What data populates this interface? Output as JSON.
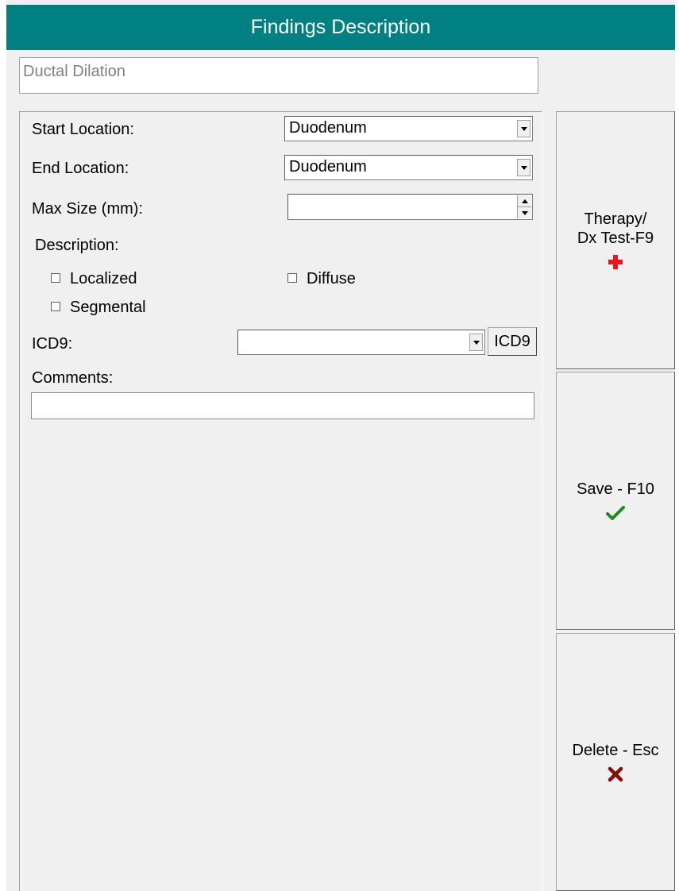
{
  "header": {
    "title": "Findings Description"
  },
  "finding_name": "Ductal Dilation",
  "form": {
    "start_location": {
      "label": "Start Location:",
      "value": "Duodenum"
    },
    "end_location": {
      "label": "End Location:",
      "value": "Duodenum"
    },
    "max_size": {
      "label": "Max Size (mm):",
      "value": ""
    },
    "description": {
      "label": "Description:",
      "options": [
        {
          "label": "Localized",
          "checked": false
        },
        {
          "label": "Diffuse",
          "checked": false
        },
        {
          "label": "Segmental",
          "checked": false
        }
      ]
    },
    "icd9": {
      "label": "ICD9:",
      "value": "",
      "button_label": "ICD9"
    },
    "comments": {
      "label": "Comments:",
      "value": ""
    }
  },
  "side_buttons": {
    "therapy": {
      "line1": "Therapy/",
      "line2": "Dx Test-F9",
      "icon": "red-cross-icon",
      "color": "#e8141e"
    },
    "save": {
      "label": "Save - F10",
      "icon": "checkmark-icon",
      "color": "#1f8a1f"
    },
    "delete": {
      "label": "Delete - Esc",
      "icon": "x-mark-icon",
      "color": "#8b0a0a"
    }
  }
}
